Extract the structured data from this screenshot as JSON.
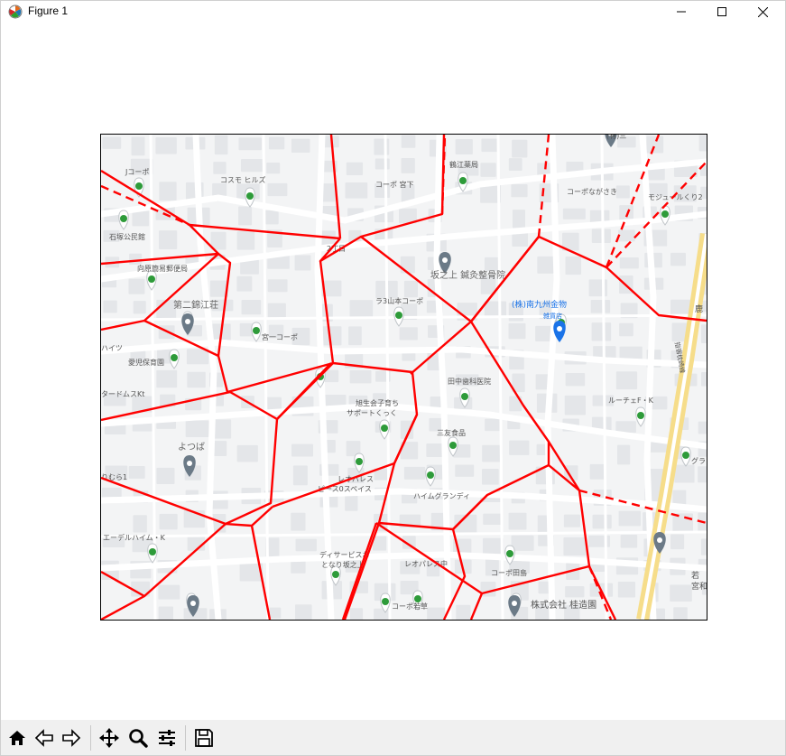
{
  "window": {
    "title": "Figure 1",
    "minimize_icon": "minimize-icon",
    "maximize_icon": "maximize-icon",
    "close_icon": "close-icon"
  },
  "map": {
    "labels": [
      {
        "text": "Jコーポ"
      },
      {
        "text": "石塚公民館"
      },
      {
        "text": "コスモ ヒルズ"
      },
      {
        "text": "コーポ 宮下"
      },
      {
        "text": "鶴江薬局"
      },
      {
        "text": "コーポながさき"
      },
      {
        "text": "モジュールくり2"
      },
      {
        "text": "向原簡易郵便局"
      },
      {
        "text": "2丁目"
      },
      {
        "text": "坂之上 鍼灸整骨院"
      },
      {
        "text": "第二錦江荘"
      },
      {
        "text": "ラ3山本コーポ"
      },
      {
        "text": "(株)南九州金物"
      },
      {
        "text": "雑貨店"
      },
      {
        "text": "宮一コーポ"
      },
      {
        "text": "ハイツ"
      },
      {
        "text": "愛児保育園"
      },
      {
        "text": "タードムスKt"
      },
      {
        "text": "田中歯科医院"
      },
      {
        "text": "旭生会子育ち"
      },
      {
        "text": "サポートくっく"
      },
      {
        "text": "ルーチェF・K"
      },
      {
        "text": "三友食品"
      },
      {
        "text": "よつば"
      },
      {
        "text": "りむら1"
      },
      {
        "text": "レオパレス"
      },
      {
        "text": "ピース0スペイス"
      },
      {
        "text": "ハイムグランディ"
      },
      {
        "text": "グラ"
      },
      {
        "text": "エーデルハイム・K"
      },
      {
        "text": "ディサービスお"
      },
      {
        "text": "となり坂之上"
      },
      {
        "text": "レオパレス中"
      },
      {
        "text": "コーポ田島"
      },
      {
        "text": "コーポ若草"
      },
      {
        "text": "株式会社 桂造園"
      },
      {
        "text": "若"
      },
      {
        "text": "宮和"
      },
      {
        "text": "鹿"
      },
      {
        "text": "指宿枕崎線"
      },
      {
        "text": "(有)三"
      }
    ],
    "colors": {
      "background": "#f3f4f5",
      "block": "#e4e6e9",
      "road": "#ffffff",
      "rail": "#f6dd8a",
      "voronoi": "#ff0000",
      "point": "#2e9b3a",
      "pin": "#6b7a87",
      "poi_blue": "#1a73e8"
    }
  },
  "toolbar": {
    "buttons": [
      {
        "name": "home",
        "icon": "home-icon"
      },
      {
        "name": "back",
        "icon": "back-arrow-icon"
      },
      {
        "name": "forward",
        "icon": "forward-arrow-icon"
      },
      {
        "name": "pan",
        "icon": "pan-icon"
      },
      {
        "name": "zoom",
        "icon": "zoom-icon"
      },
      {
        "name": "configure",
        "icon": "sliders-icon"
      },
      {
        "name": "save",
        "icon": "save-icon"
      }
    ]
  }
}
